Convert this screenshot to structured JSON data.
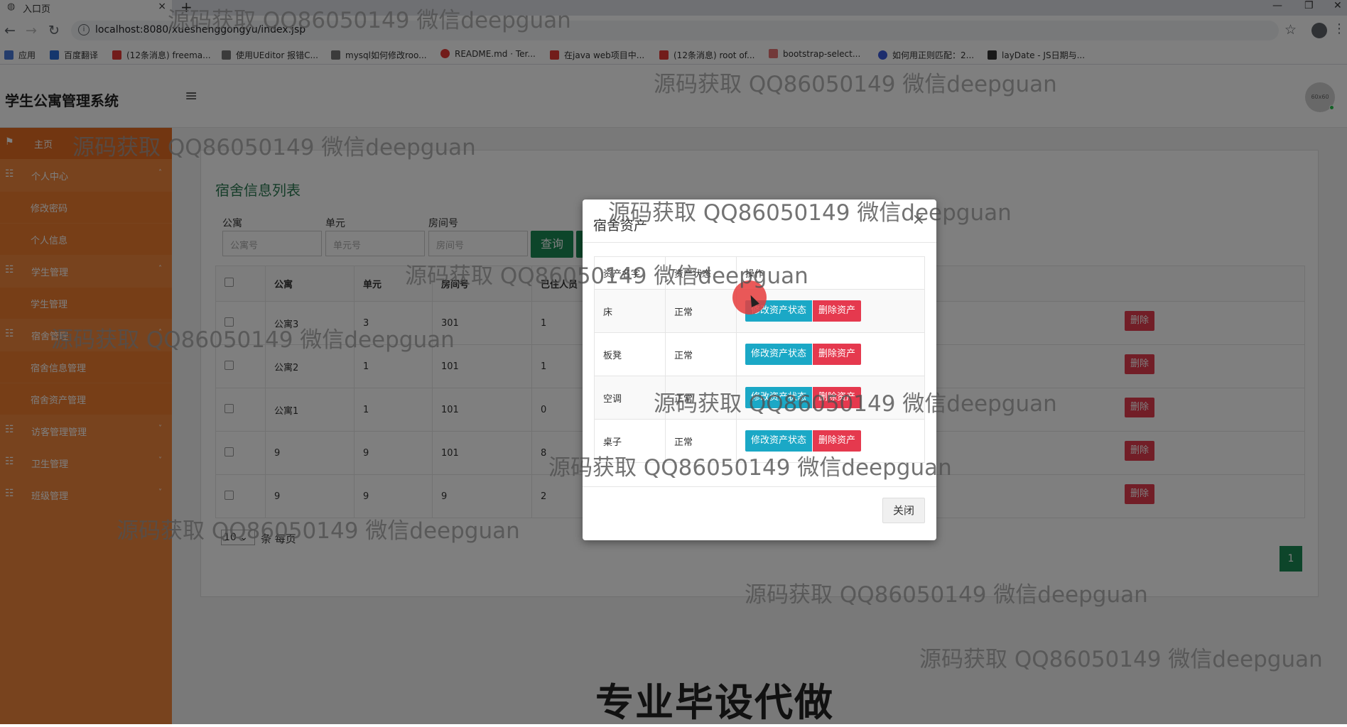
{
  "browser": {
    "tab_title": "入口页",
    "tab_close": "×",
    "new_tab": "+",
    "url": "localhost:8080/xueshenggongyu/index.jsp",
    "bookmarks": [
      {
        "label": "应用",
        "color": "#4a7bd8"
      },
      {
        "label": "百度翻译",
        "color": "#2a6fdb"
      },
      {
        "label": "(12条消息) freema...",
        "color": "#e53935"
      },
      {
        "label": "使用UEditor 报错C...",
        "color": "#555555"
      },
      {
        "label": "mysql如何修改roo...",
        "color": "#555555"
      },
      {
        "label": "README.md · Ter...",
        "color": "#e53935"
      },
      {
        "label": "在java web项目中...",
        "color": "#e53935"
      },
      {
        "label": "(12条消息) root of...",
        "color": "#e53935"
      },
      {
        "label": "bootstrap-select...",
        "color": "#e53935"
      },
      {
        "label": "如何用正则匹配：2...",
        "color": "#3b5bdb"
      },
      {
        "label": "layDate - JS日期与...",
        "color": "#333333"
      }
    ]
  },
  "app": {
    "title": "学生公寓管理系统",
    "avatar_text": "60x60"
  },
  "sidebar": {
    "items": [
      {
        "label": "主页",
        "type": "active"
      },
      {
        "label": "个人中心",
        "type": "group",
        "chevron": "˄"
      },
      {
        "label": "修改密码",
        "type": "sub"
      },
      {
        "label": "个人信息",
        "type": "sub"
      },
      {
        "label": "学生管理",
        "type": "group",
        "chevron": "˄"
      },
      {
        "label": "学生管理",
        "type": "sub"
      },
      {
        "label": "宿舍管理",
        "type": "group",
        "chevron": "˄"
      },
      {
        "label": "宿舍信息管理",
        "type": "sub"
      },
      {
        "label": "宿舍资产管理",
        "type": "sub"
      },
      {
        "label": "访客管理管理",
        "type": "group",
        "chevron": "˅"
      },
      {
        "label": "卫生管理",
        "type": "group",
        "chevron": "˅"
      },
      {
        "label": "班级管理",
        "type": "group",
        "chevron": "˅"
      }
    ]
  },
  "main": {
    "title": "宿舍信息列表",
    "filters": [
      {
        "label": "公寓",
        "placeholder": "公寓号"
      },
      {
        "label": "单元",
        "placeholder": "单元号"
      },
      {
        "label": "房间号",
        "placeholder": "房间号"
      }
    ],
    "query_button": "查询",
    "table": {
      "headers": [
        "公寓",
        "单元",
        "房间号",
        "已住人员"
      ],
      "rows": [
        [
          "公寓3",
          "3",
          "301",
          "1"
        ],
        [
          "公寓2",
          "1",
          "101",
          "1"
        ],
        [
          "公寓1",
          "1",
          "101",
          "0"
        ],
        [
          "9",
          "9",
          "101",
          "8"
        ],
        [
          "9",
          "9",
          "9",
          "2"
        ]
      ],
      "row_action_stub": "删除"
    },
    "page_size": "10",
    "page_size_suffix": "条 每页",
    "current_page": "1"
  },
  "modal": {
    "title": "宿舍资产",
    "close_x": "×",
    "headers": [
      "资产名字",
      "资产状态",
      "操作"
    ],
    "rows": [
      {
        "name": "床",
        "status": "正常"
      },
      {
        "name": "板凳",
        "status": "正常"
      },
      {
        "name": "空调",
        "status": "正常"
      },
      {
        "name": "桌子",
        "status": "正常"
      }
    ],
    "edit_button": "修改资产状态",
    "delete_button": "删除资产",
    "close_button": "关闭"
  },
  "watermark": "源码获取 QQ86050149 微信deepguan",
  "caption": "专业毕设代做",
  "colors": {
    "sidebar": "#f1863c",
    "sidebar_active": "#e46c22",
    "primary_green": "#1b8a55",
    "info_blue": "#1ba8c6",
    "danger_red": "#e5394e"
  }
}
